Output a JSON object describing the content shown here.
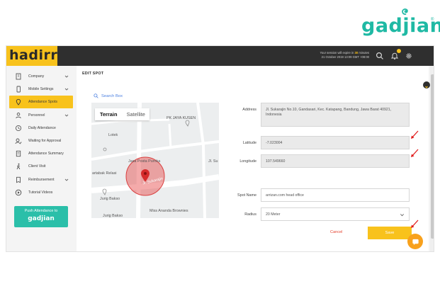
{
  "brand": {
    "outer_logo": "gadjian",
    "registered": "®",
    "app_logo": "hadirr",
    "push_card_logo": "gadjian"
  },
  "topbar": {
    "session_text": "Your session will expire in",
    "session_minutes": "30",
    "session_unit": "minutes",
    "session_date": "21 October 2019 13:09 GMT +08:00"
  },
  "sidebar": {
    "items": [
      {
        "label": "Company",
        "icon": "building-icon",
        "has_chevron": true
      },
      {
        "label": "Mobile Settings",
        "icon": "phone-icon",
        "has_chevron": true
      },
      {
        "label": "Attendance Spots",
        "icon": "pin-icon",
        "active": true
      },
      {
        "label": "Personnel",
        "icon": "person-icon",
        "has_chevron": true
      },
      {
        "label": "Daily Attendance",
        "icon": "clock-icon"
      },
      {
        "label": "Waiting for Approval",
        "icon": "approval-icon"
      },
      {
        "label": "Attendance Summary",
        "icon": "summary-icon"
      },
      {
        "label": "Client Visit",
        "icon": "walk-icon"
      },
      {
        "label": "Reimbursement",
        "icon": "receipt-icon",
        "has_chevron": true
      },
      {
        "label": "Tutorial Videos",
        "icon": "play-icon"
      }
    ],
    "push_card_text": "Push Attendance to"
  },
  "main": {
    "title": "EDIT SPOT",
    "search_label": "Search Box",
    "map": {
      "tab_terrain": "Terrain",
      "tab_satellite": "Satellite",
      "place_labels": [
        "PK JAYA KUSEN",
        "Lotek",
        "Jasa Posta Purnka",
        "Jl. Sukarajin",
        "Jl. Su",
        "artabak Relasi",
        "Jurig Bakso",
        "Jurig Bakso",
        "Miss Ananda Brownies"
      ]
    },
    "address_label": "Address",
    "address_value": "Jl. Sukarajin No.10, Gandasari, Kec. Katapang, Bandung, Jawa Barat 40921, Indonesia",
    "latitude_label": "Latitude",
    "latitude_value": "-7.023004",
    "longitude_label": "Longitude",
    "longitude_value": "107.549660",
    "spot_name_label": "Spot Name",
    "spot_name_value": "arrizan.com head office",
    "radius_label": "Radius",
    "radius_value": "20 Meter",
    "cancel_label": "Cancel",
    "save_label": "Save"
  },
  "colors": {
    "accent": "#f8c21c",
    "brand_teal": "#1fb9a4",
    "topbar": "#2f2f2f",
    "danger": "#e5432f",
    "link": "#4a7fe0"
  }
}
